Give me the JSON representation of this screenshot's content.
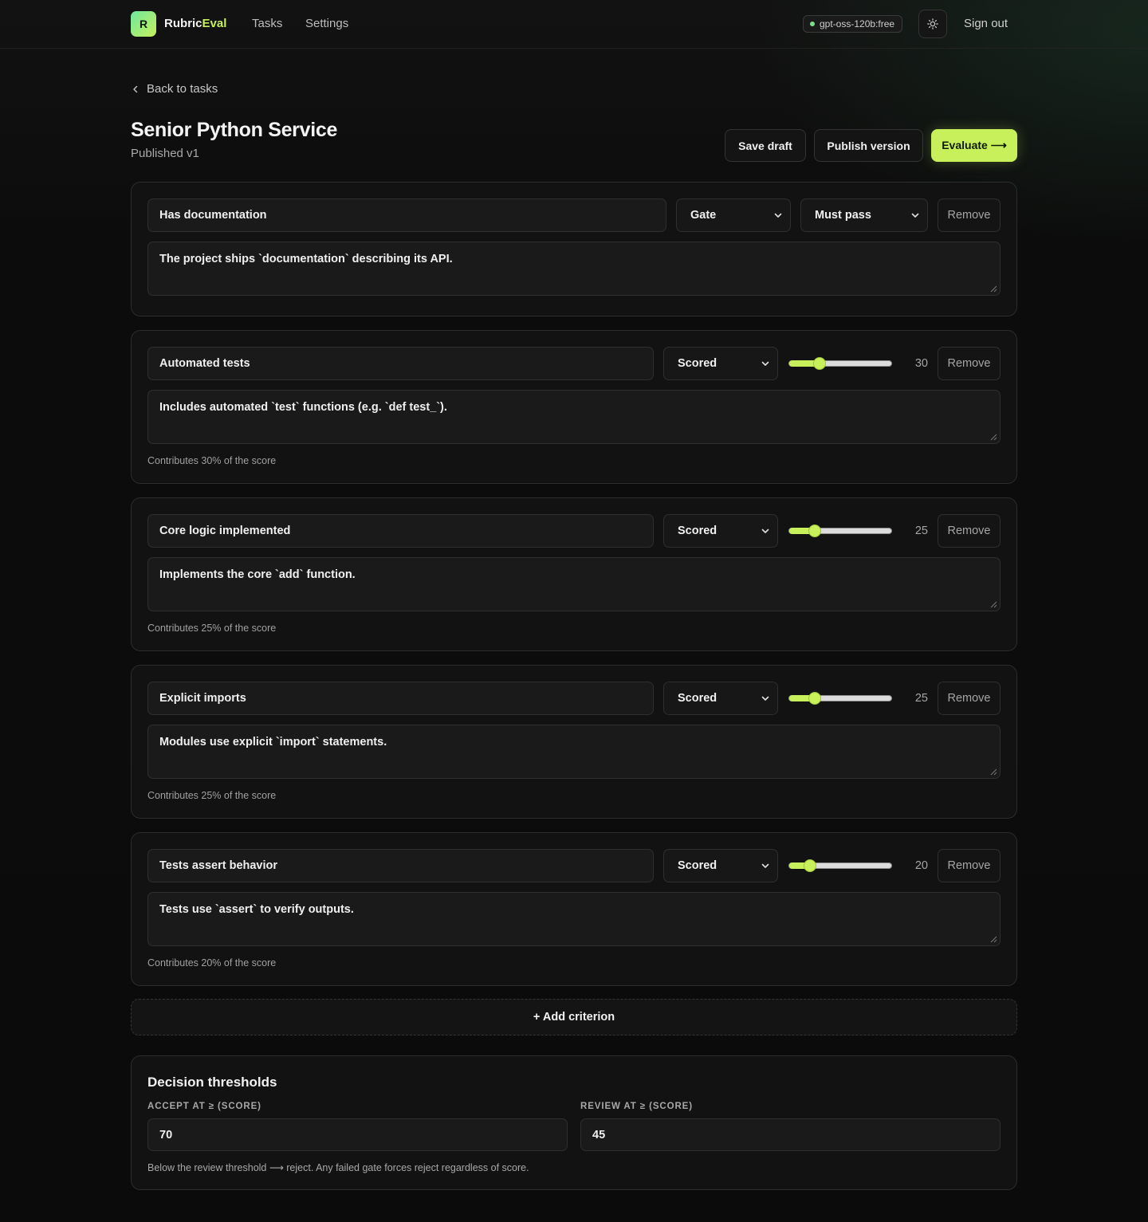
{
  "nav": {
    "logo_letter": "R",
    "brand_prefix": "Rubric",
    "brand_suffix": "Eval",
    "links": [
      "Tasks",
      "Settings"
    ],
    "model": "gpt-oss-120b:free",
    "theme_icon": "sun-icon",
    "sign_out": "Sign out"
  },
  "page": {
    "back_label": "Back to tasks",
    "title": "Senior Python Service",
    "subtitle": "Published v1",
    "actions": {
      "save_draft": "Save draft",
      "publish": "Publish version",
      "evaluate": "Evaluate ⟶"
    }
  },
  "colors": {
    "accent": "#c7f05a",
    "background": "#0b0b0b",
    "card": "#121212"
  },
  "criteria": [
    {
      "name": "Has documentation",
      "type": "Gate",
      "gate_mode": "Must pass",
      "description": "The project ships `documentation` describing its API.",
      "remove_label": "Remove"
    },
    {
      "name": "Automated tests",
      "type": "Scored",
      "weight": 30,
      "weight_max": 100,
      "description": "Includes automated `test` functions (e.g. `def test_`).",
      "contribution": "Contributes 30% of the score",
      "remove_label": "Remove"
    },
    {
      "name": "Core logic implemented",
      "type": "Scored",
      "weight": 25,
      "weight_max": 100,
      "description": "Implements the core `add` function.",
      "contribution": "Contributes 25% of the score",
      "remove_label": "Remove"
    },
    {
      "name": "Explicit imports",
      "type": "Scored",
      "weight": 25,
      "weight_max": 100,
      "description": "Modules use explicit `import` statements.",
      "contribution": "Contributes 25% of the score",
      "remove_label": "Remove"
    },
    {
      "name": "Tests assert behavior",
      "type": "Scored",
      "weight": 20,
      "weight_max": 100,
      "description": "Tests use `assert` to verify outputs.",
      "contribution": "Contributes 20% of the score",
      "remove_label": "Remove"
    }
  ],
  "add_criterion": "+ Add criterion",
  "thresholds": {
    "title": "Decision thresholds",
    "accept_label": "ACCEPT AT ≥ (SCORE)",
    "accept_value": "70",
    "review_label": "REVIEW AT ≥ (SCORE)",
    "review_value": "45",
    "note": "Below the review threshold ⟶ reject. Any failed gate forces reject regardless of score."
  }
}
